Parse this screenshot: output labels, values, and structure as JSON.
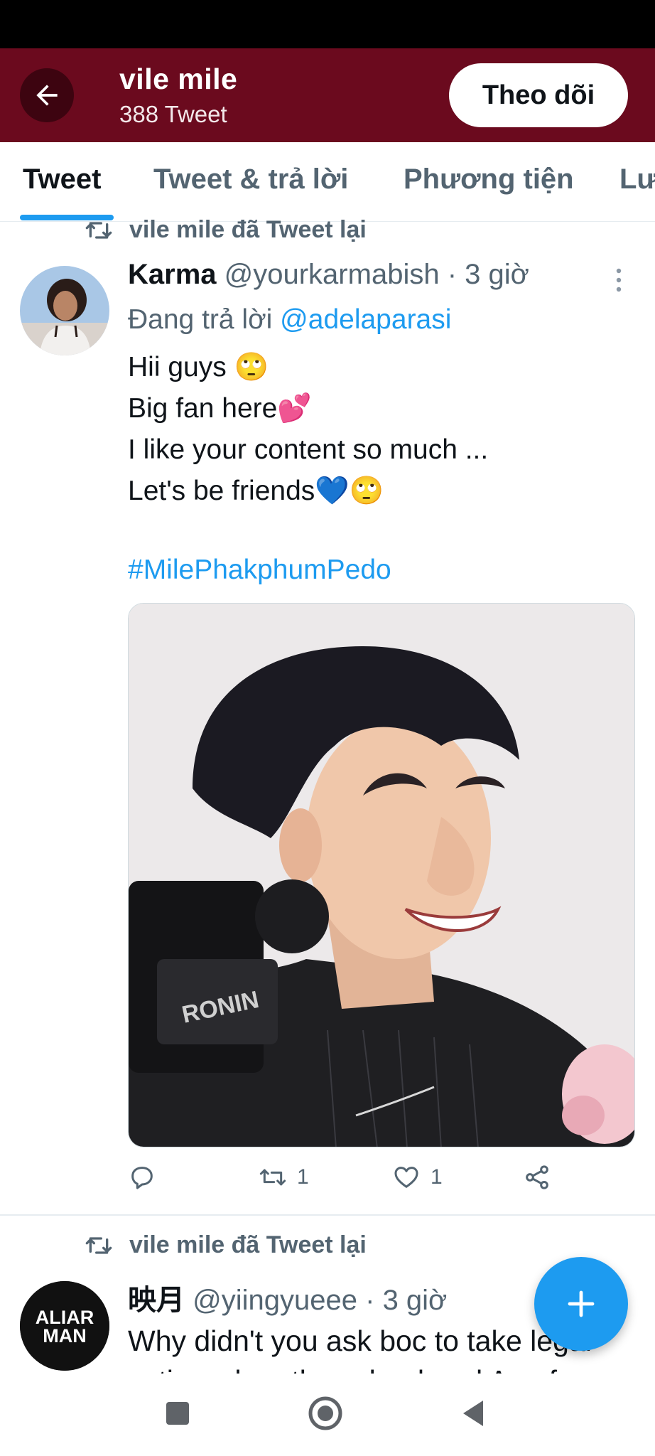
{
  "header": {
    "title": "vile mile",
    "subtitle": "388 Tweet",
    "follow_label": "Theo dõi",
    "background_color": "#6b0a1e"
  },
  "tabs": [
    {
      "label": "Tweet",
      "active": true
    },
    {
      "label": "Tweet & trả lời",
      "active": false
    },
    {
      "label": "Phương tiện",
      "active": false
    },
    {
      "label": "Lượt thích",
      "active": false
    }
  ],
  "tweets": [
    {
      "retweet_label": "vile mile đã Tweet lại",
      "author_name": "Karma",
      "handle": "@yourkarmabish",
      "separator": "·",
      "time": "3 giờ",
      "reply_prefix": "Đang trả lời",
      "reply_mention": "@adelaparasi",
      "lines": [
        "Hii guys 🙄",
        "Big fan here💕",
        "I like your content so much ...",
        "Let's be friends💙🙄"
      ],
      "hashtag": "#MilePhakphumPedo",
      "media_watermark": "RONIN",
      "retweet_count": "1",
      "like_count": "1"
    },
    {
      "retweet_label": "vile mile đã Tweet lại",
      "author_name": "映月",
      "handle": "@yiingyueee",
      "separator": "·",
      "time": "3 giờ",
      "avatar_text_top": "ALIAR",
      "avatar_text_bottom": "MAN",
      "lines": [
        "Why didn't you ask boc to take legal",
        "action when they slandered Apo for"
      ]
    }
  ],
  "icons": {
    "back": "arrow-left-icon",
    "retweet": "retweet-icon",
    "more": "more-vertical-icon",
    "reply": "reply-icon",
    "like": "heart-icon",
    "share": "share-icon",
    "compose": "plus-icon",
    "nav_recents": "square-icon",
    "nav_home": "circle-icon",
    "nav_back": "triangle-back-icon"
  },
  "colors": {
    "accent": "#1d9bf0",
    "muted_text": "#536471"
  }
}
